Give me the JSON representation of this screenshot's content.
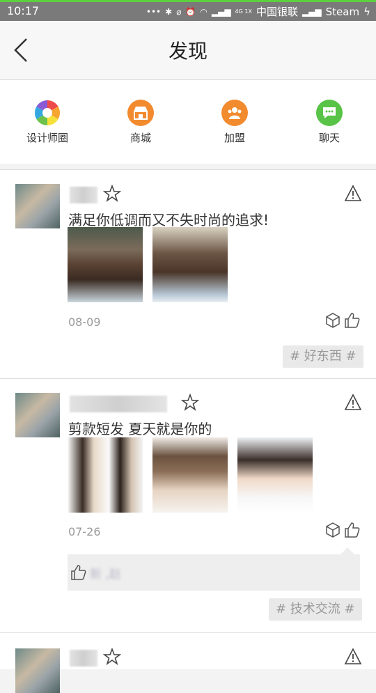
{
  "status_bar": {
    "time": "10:17",
    "carrier": "中国银联",
    "network_label": "Steam",
    "net_type": "4G 1X"
  },
  "navbar": {
    "title": "发现"
  },
  "shortcuts": [
    {
      "label": "设计师圈",
      "icon": "aperture-icon",
      "color": "#ffffff"
    },
    {
      "label": "商城",
      "icon": "shop-icon",
      "color": "#f28a2e"
    },
    {
      "label": "加盟",
      "icon": "group-icon",
      "color": "#f28a2e"
    },
    {
      "label": "聊天",
      "icon": "chat-icon",
      "color": "#58c346"
    }
  ],
  "posts": [
    {
      "text": "满足你低调而又不失时尚的追求!",
      "date": "08-09",
      "tag": "# 好东西 #"
    },
    {
      "text": "剪款短发  夏天就是你的",
      "date": "07-26",
      "tag": "# 技术交流 #",
      "likes_text": "新 ,赵"
    }
  ],
  "colors": {
    "accent_orange": "#f28a2e",
    "accent_green": "#58c346"
  }
}
